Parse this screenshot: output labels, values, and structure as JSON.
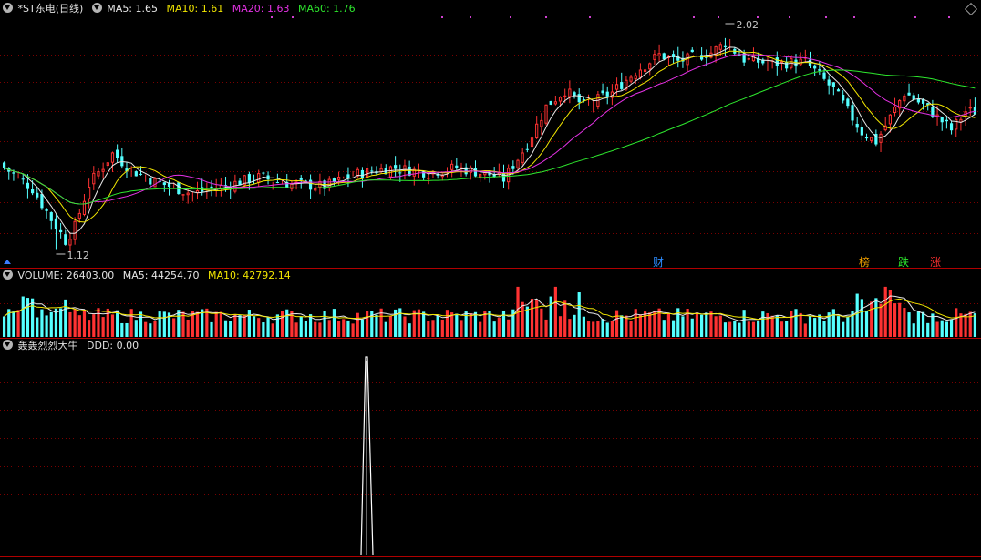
{
  "price_panel": {
    "title": "*ST东电(日线)",
    "ma5": {
      "label": "MA5:",
      "value": "1.65",
      "color": "#e8e8e8"
    },
    "ma10": {
      "label": "MA10:",
      "value": "1.61",
      "color": "#f2e600"
    },
    "ma20": {
      "label": "MA20:",
      "value": "1.63",
      "color": "#e632e6"
    },
    "ma60": {
      "label": "MA60:",
      "value": "1.76",
      "color": "#2ee82e"
    },
    "high_label": "2.02",
    "low_label": "1.12",
    "markers": [
      {
        "text": "财",
        "color": "#2c8cff"
      },
      {
        "text": "榜",
        "color": "#f0a000"
      },
      {
        "text": "跌",
        "color": "#2ee82e"
      },
      {
        "text": "涨",
        "color": "#ff3030"
      }
    ]
  },
  "volume_panel": {
    "title": "VOLUME:",
    "value": "26403.00",
    "ma5": {
      "label": "MA5:",
      "value": "44254.70",
      "color": "#e8e8e8"
    },
    "ma10": {
      "label": "MA10:",
      "value": "42792.14",
      "color": "#f2e600"
    }
  },
  "indicator_panel": {
    "title": "轰轰烈烈大牛",
    "ddd": {
      "label": "DDD:",
      "value": "0.00"
    }
  },
  "colors": {
    "up": "#ff3232",
    "down": "#54ffff",
    "grid": "#7a0000",
    "separator": "#b00000",
    "spike": "#ffffff"
  },
  "chart_data": {
    "type": "candlestick",
    "high": 2.02,
    "low": 1.12,
    "last": {
      "ma5": 1.65,
      "ma10": 1.61,
      "ma20": 1.63,
      "ma60": 1.76,
      "volume": 26403.0,
      "vol_ma5": 44254.7,
      "vol_ma10": 42792.14,
      "ddd": 0.0
    }
  }
}
